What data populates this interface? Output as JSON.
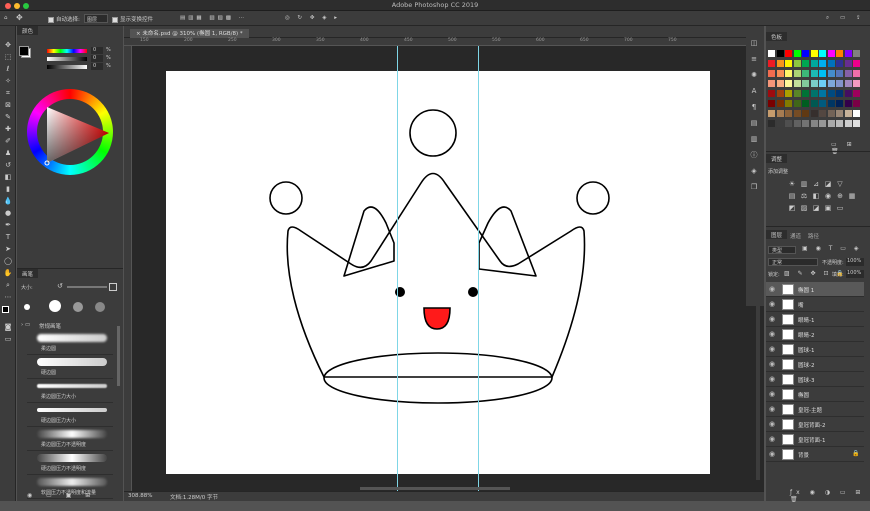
{
  "app": {
    "window_title": "Adobe Photoshop CC 2019"
  },
  "options_bar": {
    "auto_select_label": "自动选择:",
    "auto_select_value": "图层",
    "show_transform_label": "显示变换控件"
  },
  "document": {
    "tab_title": "未命名.psd @ 310% (椭圆 1, RGB/8) *",
    "zoom": "308.88%",
    "doc_info": "文档:1.28M/0 字节"
  },
  "ruler_labels": [
    "150",
    "200",
    "250",
    "300",
    "350",
    "400",
    "450",
    "500",
    "550",
    "600",
    "650",
    "700",
    "750"
  ],
  "color_panel": {
    "title": "颜色",
    "value_labels": [
      "%",
      "%",
      "%"
    ],
    "value_numbers": [
      "0",
      "0",
      "0"
    ]
  },
  "brush_panel": {
    "title": "画笔",
    "size_label": "大小:",
    "group_name": "常规画笔",
    "brushes": [
      "柔边圆",
      "硬边圆",
      "柔边圆压力大小",
      "硬边圆压力大小",
      "柔边圆压力不透明度",
      "硬边圆压力不透明度",
      "软圆压力不透明度和流量"
    ]
  },
  "swatches_panel": {
    "title": "色板"
  },
  "adjust_panel": {
    "title": "调整",
    "subtitle": "添加调整"
  },
  "layers_panel": {
    "tabs": [
      "图层",
      "通道",
      "路径"
    ],
    "kind_label": "类型",
    "blend_mode": "正常",
    "opacity_label": "不透明度:",
    "opacity_value": "100%",
    "lock_label": "锁定:",
    "fill_label": "填充:",
    "fill_value": "100%",
    "layers": [
      "椭圆 1",
      "嘴",
      "眼睛-1",
      "眼睛-2",
      "圆球-1",
      "圆球-2",
      "圆球-3",
      "椭圆",
      "皇冠-主题",
      "皇冠背面-2",
      "皇冠背面-1",
      "背景"
    ]
  }
}
